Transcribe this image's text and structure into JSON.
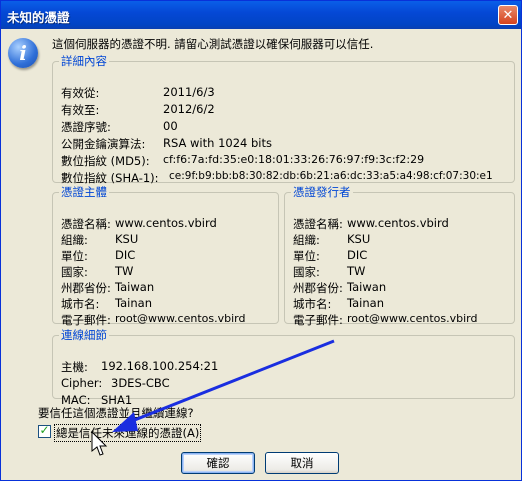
{
  "window": {
    "title": "未知的憑證",
    "close_glyph": "✕"
  },
  "icon": {
    "name": "info-icon",
    "glyph": "i"
  },
  "message": "這個伺服器的憑證不明. 請留心測試憑證以確保伺服器可以信任.",
  "details": {
    "legend": "詳細內容",
    "rows": [
      {
        "label": "有效從:",
        "value": "2011/6/3"
      },
      {
        "label": "有效至:",
        "value": "2012/6/2"
      },
      {
        "label": "憑證序號:",
        "value": "00"
      },
      {
        "label": "公開金鑰演算法:",
        "value": "RSA with 1024 bits"
      },
      {
        "label": "數位指紋 (MD5):",
        "value": "cf:f6:7a:fd:35:e0:18:01:33:26:76:97:f9:3c:f2:29"
      },
      {
        "label": "數位指紋 (SHA-1):",
        "value": "ce:9f:b9:bb:b8:30:82:db:6b:21:a6:dc:33:a5:a4:98:cf:07:30:e1"
      }
    ]
  },
  "subject": {
    "legend": "憑證主體",
    "rows": [
      {
        "label": "憑證名稱:",
        "value": "www.centos.vbird"
      },
      {
        "label": "組織:",
        "value": "KSU"
      },
      {
        "label": "單位:",
        "value": "DIC"
      },
      {
        "label": "國家:",
        "value": "TW"
      },
      {
        "label": "州郡省份:",
        "value": "Taiwan"
      },
      {
        "label": "城市名:",
        "value": "Tainan"
      },
      {
        "label": "電子郵件:",
        "value": "root@www.centos.vbird"
      }
    ]
  },
  "issuer": {
    "legend": "憑證發行者",
    "rows": [
      {
        "label": "憑證名稱:",
        "value": "www.centos.vbird"
      },
      {
        "label": "組織:",
        "value": "KSU"
      },
      {
        "label": "單位:",
        "value": "DIC"
      },
      {
        "label": "國家:",
        "value": "TW"
      },
      {
        "label": "州郡省份:",
        "value": "Taiwan"
      },
      {
        "label": "城市名:",
        "value": "Tainan"
      },
      {
        "label": "電子郵件:",
        "value": "root@www.centos.vbird"
      }
    ]
  },
  "connection": {
    "legend": "連線細節",
    "rows": [
      {
        "label": "主機:",
        "value": "192.168.100.254:21"
      },
      {
        "label": "Cipher:",
        "value": "3DES-CBC"
      },
      {
        "label": "MAC:",
        "value": "SHA1"
      }
    ]
  },
  "question": "要信任這個憑證並且繼續連線?",
  "always_trust": {
    "label": "總是信任未來連線的憑證(A)",
    "checked": true,
    "check_glyph": "✓"
  },
  "buttons": {
    "ok": "確認",
    "cancel": "取消"
  },
  "annotation": {
    "color": "#1a2ee0"
  }
}
